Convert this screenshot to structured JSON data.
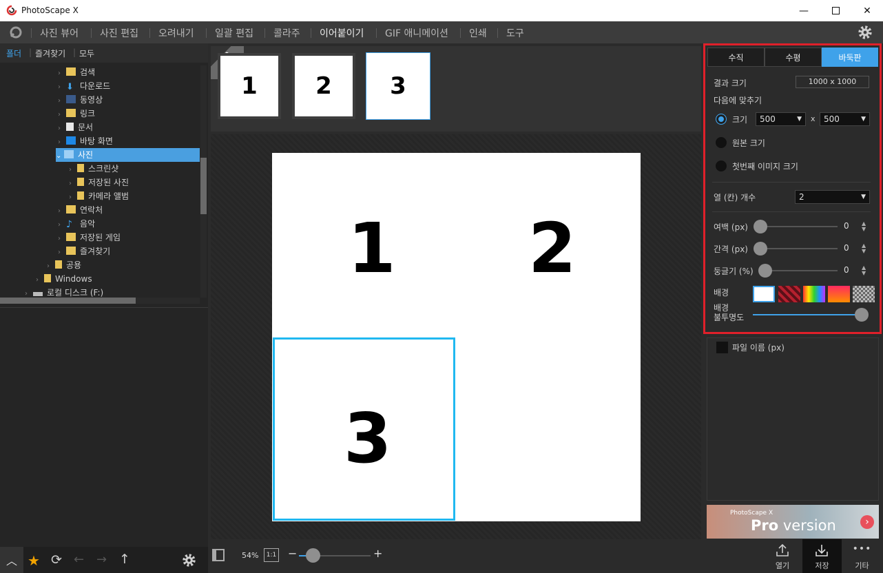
{
  "window": {
    "title": "PhotoScape X",
    "minimize_icon": "minimize-icon",
    "maximize_icon": "maximize-icon",
    "close_icon": "close-icon"
  },
  "menu": {
    "items": [
      "사진 뷰어",
      "사진 편집",
      "오려내기",
      "일괄 편집",
      "콜라주",
      "이어붙이기",
      "GIF 애니메이션",
      "인쇄",
      "도구"
    ],
    "active_index": 5
  },
  "left_tabs": [
    "폴더",
    "즐겨찾기",
    "모두"
  ],
  "tree": [
    {
      "label": "검색",
      "depth": 2
    },
    {
      "label": "다운로드",
      "depth": 2
    },
    {
      "label": "동영상",
      "depth": 2
    },
    {
      "label": "링크",
      "depth": 2
    },
    {
      "label": "문서",
      "depth": 2
    },
    {
      "label": "바탕 화면",
      "depth": 2
    },
    {
      "label": "사진",
      "depth": 2,
      "selected": true
    },
    {
      "label": "스크린샷",
      "depth": 3
    },
    {
      "label": "저장된 사진",
      "depth": 3
    },
    {
      "label": "카메라 앨범",
      "depth": 3
    },
    {
      "label": "연락처",
      "depth": 2
    },
    {
      "label": "음악",
      "depth": 2
    },
    {
      "label": "저장된 게임",
      "depth": 2
    },
    {
      "label": "즐겨찾기",
      "depth": 2
    },
    {
      "label": "공용",
      "depth": 1
    },
    {
      "label": "Windows",
      "depth": 0
    },
    {
      "label": "로컬 디스크 (F:)",
      "depth": -1
    }
  ],
  "pro_badge": {
    "line1": "PRO",
    "line2": "Version"
  },
  "thumbnails": [
    "1",
    "2",
    "3"
  ],
  "canvas_cells": [
    "1",
    "2",
    "3"
  ],
  "zoom": {
    "value": "54%",
    "one_to_one": "1:1",
    "minus": "−",
    "plus": "+"
  },
  "right_panel": {
    "tabs": [
      "수직",
      "수평",
      "바둑판"
    ],
    "active_tab": 2,
    "result_size_label": "결과 크기",
    "result_size_value": "1000 x 1000",
    "fit_label": "다음에 맞추기",
    "size_label": "크기",
    "size_w": "500",
    "size_x": "x",
    "size_h": "500",
    "original_size_label": "원본 크기",
    "first_image_size_label": "첫번째 이미지 크기",
    "columns_label": "열 (칸) 개수",
    "columns_value": "2",
    "margin_label": "여백 (px)",
    "margin_value": "0",
    "spacing_label": "간격 (px)",
    "spacing_value": "0",
    "round_label": "둥글기 (%)",
    "round_value": "0",
    "background_label": "배경",
    "opacity_label_1": "배경",
    "opacity_label_2": "불투명도",
    "opacity_level": 1.0,
    "filename_label": "파일 이름 (px)"
  },
  "promo": {
    "small": "PhotoScape X",
    "big_a": "Pro",
    "big_b": " version"
  },
  "bottom_right": {
    "open": "열기",
    "save": "저장",
    "more": "기타"
  }
}
